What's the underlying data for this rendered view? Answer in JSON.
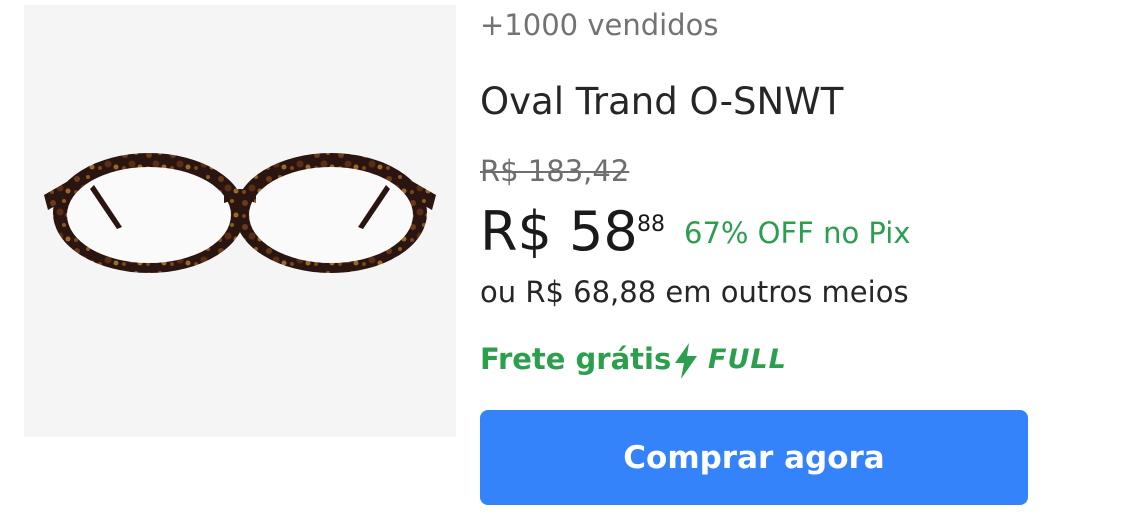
{
  "product": {
    "sold_count": "+1000 vendidos",
    "title": "Oval Trand O-SNWT",
    "original_price": "R$ 183,42",
    "price_main": "R$ 58",
    "price_cents": "88",
    "discount": "67% OFF no Pix",
    "installments": "ou R$ 68,88 em outros meios",
    "shipping_label": "Frete grátis",
    "shipping_icon": "bolt-icon",
    "shipping_tag": "FULL",
    "buy_button_label": "Comprar agora",
    "image_alt": "glasses-image"
  },
  "colors": {
    "accent_green": "#2b9f4e",
    "button_blue": "#3483fa",
    "image_bg": "#f5f5f5"
  }
}
